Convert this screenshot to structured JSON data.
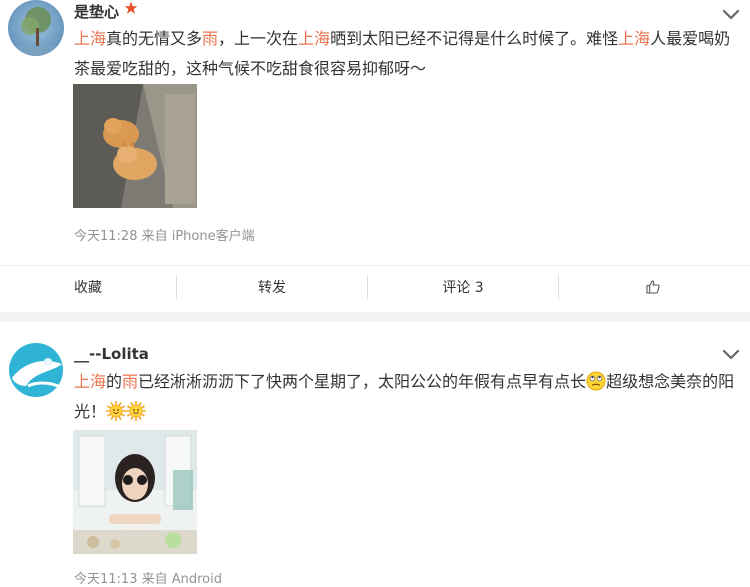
{
  "posts": [
    {
      "username": "是垫心",
      "content": [
        {
          "t": "上海",
          "hl": true
        },
        {
          "t": "真的无情又多",
          "hl": false
        },
        {
          "t": "雨",
          "hl": true
        },
        {
          "t": "，上一次在",
          "hl": false
        },
        {
          "t": "上海",
          "hl": true
        },
        {
          "t": "晒到太阳已经不记得是什么时候了。难怪",
          "hl": false
        },
        {
          "t": "上海",
          "hl": true
        },
        {
          "t": "人最爱喝奶茶最爱吃甜的，这种气候不吃甜食很容易抑郁呀～",
          "hl": false
        }
      ],
      "meta": "今天11:28 来自 iPhone客户端",
      "actions": {
        "fav": "收藏",
        "repost": "转发",
        "comment": "评论 3"
      }
    },
    {
      "username": "__--Lolita",
      "content": [
        {
          "t": "上海",
          "hl": true
        },
        {
          "t": "的",
          "hl": false
        },
        {
          "t": "雨",
          "hl": true
        },
        {
          "t": "已经淅淅沥沥下了快两个星期了，太阳公公的年假有点早有点长",
          "hl": false
        },
        {
          "t": "[emoji-roll]",
          "emoji": true
        },
        {
          "t": "超级想念美奈的阳光！",
          "hl": false
        },
        {
          "t": "[emoji-sun]",
          "emoji": true
        },
        {
          "t": "[emoji-sun]",
          "emoji": true
        }
      ],
      "meta": "今天11:13 来自 Android"
    }
  ],
  "colors": {
    "highlight": "#eb7350",
    "meta": "#939393",
    "divider": "#f2f2f2"
  },
  "icons": [
    "chevron-down-icon",
    "thumbs-up-icon",
    "verified-star-icon",
    "emoji-roll-eyes-icon",
    "emoji-sun-icon"
  ]
}
